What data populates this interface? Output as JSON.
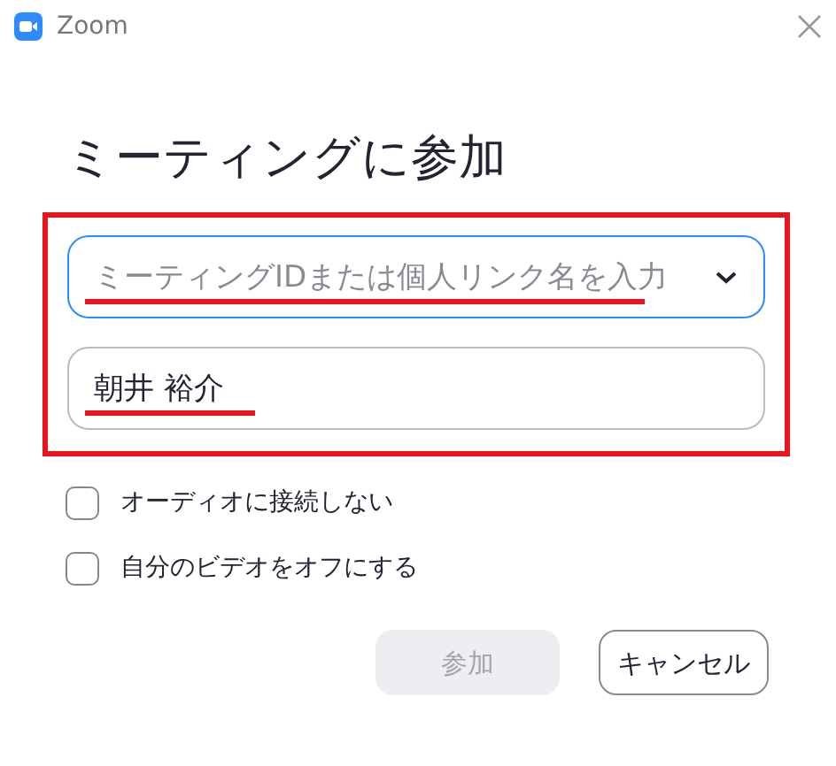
{
  "window": {
    "title": "Zoom"
  },
  "heading": "ミーティングに参加",
  "meeting_field": {
    "placeholder": "ミーティングIDまたは個人リンク名を入力",
    "focused": true
  },
  "name_field": {
    "value": "朝井 裕介"
  },
  "options": [
    {
      "label": "オーディオに接続しない",
      "checked": false
    },
    {
      "label": "自分のビデオをオフにする",
      "checked": false
    }
  ],
  "buttons": [
    {
      "label": "参加",
      "kind": "primary",
      "disabled": true
    },
    {
      "label": "キャンセル",
      "kind": "secondary",
      "disabled": false
    }
  ]
}
